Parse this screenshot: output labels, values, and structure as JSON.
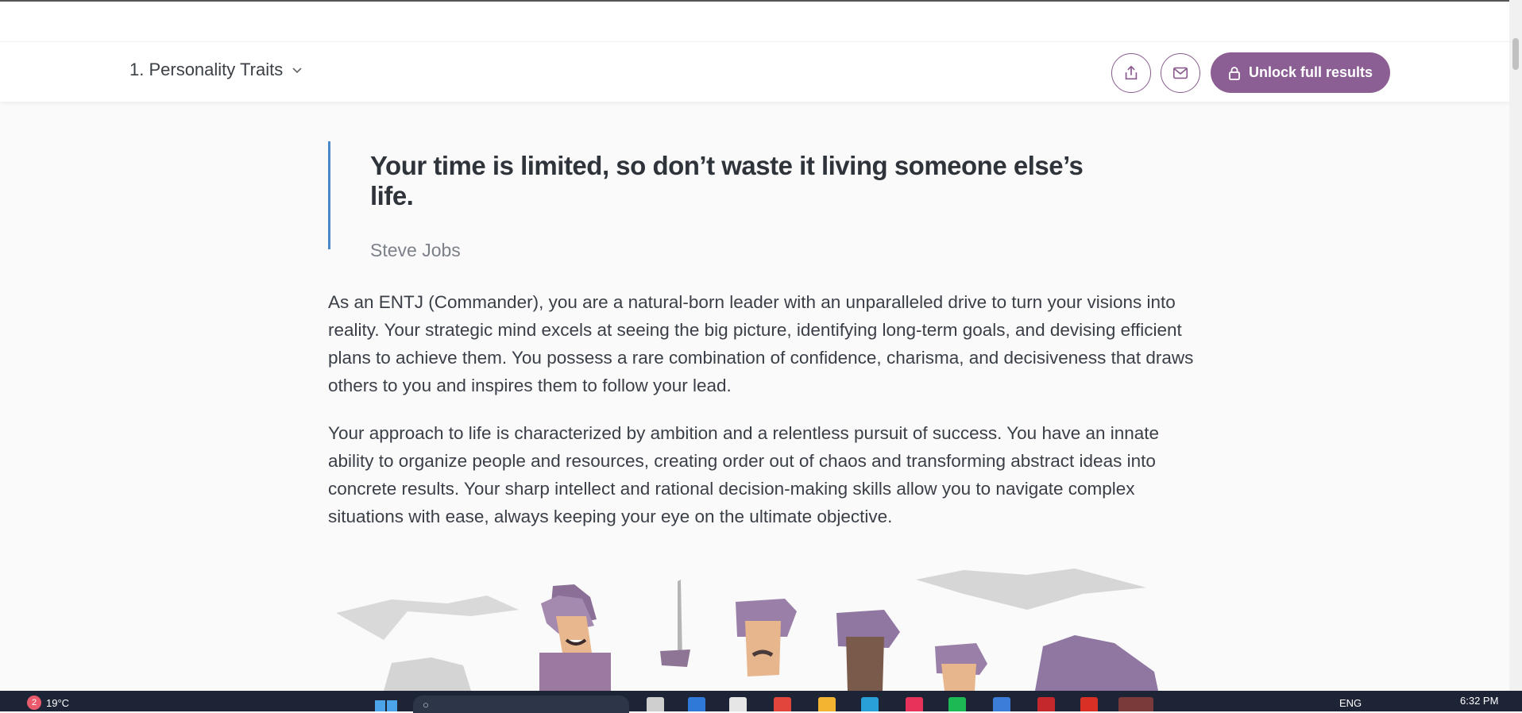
{
  "header": {
    "section_title": "1. Personality Traits",
    "unlock_label": "Unlock full results"
  },
  "quote": {
    "text": "Your time is limited, so don’t waste it living someone else’s life.",
    "author": "Steve Jobs"
  },
  "paragraphs": [
    "As an ENTJ (Commander), you are a natural-born leader with an unparalleled drive to turn your visions into reality. Your strategic mind excels at seeing the big picture, identifying long-term goals, and devising efficient plans to achieve them. You possess a rare combination of confidence, charisma, and decisiveness that draws others to you and inspires them to follow your lead.",
    "Your approach to life is characterized by ambition and a relentless pursuit of success. You have an innate ability to organize people and resources, creating order out of chaos and transforming abstract ideas into concrete results. Your sharp intellect and rational decision-making skills allow you to navigate complex situations with ease, always keeping your eye on the ultimate objective."
  ],
  "taskbar": {
    "weather_badge": "2",
    "weather_temp": "19°C",
    "search_placeholder": "Search",
    "language": "ENG",
    "time": "6:32 PM"
  },
  "colors": {
    "accent": "#8c5f94",
    "quote_bar": "#4a88c7",
    "taskbar": "#1c2436"
  }
}
